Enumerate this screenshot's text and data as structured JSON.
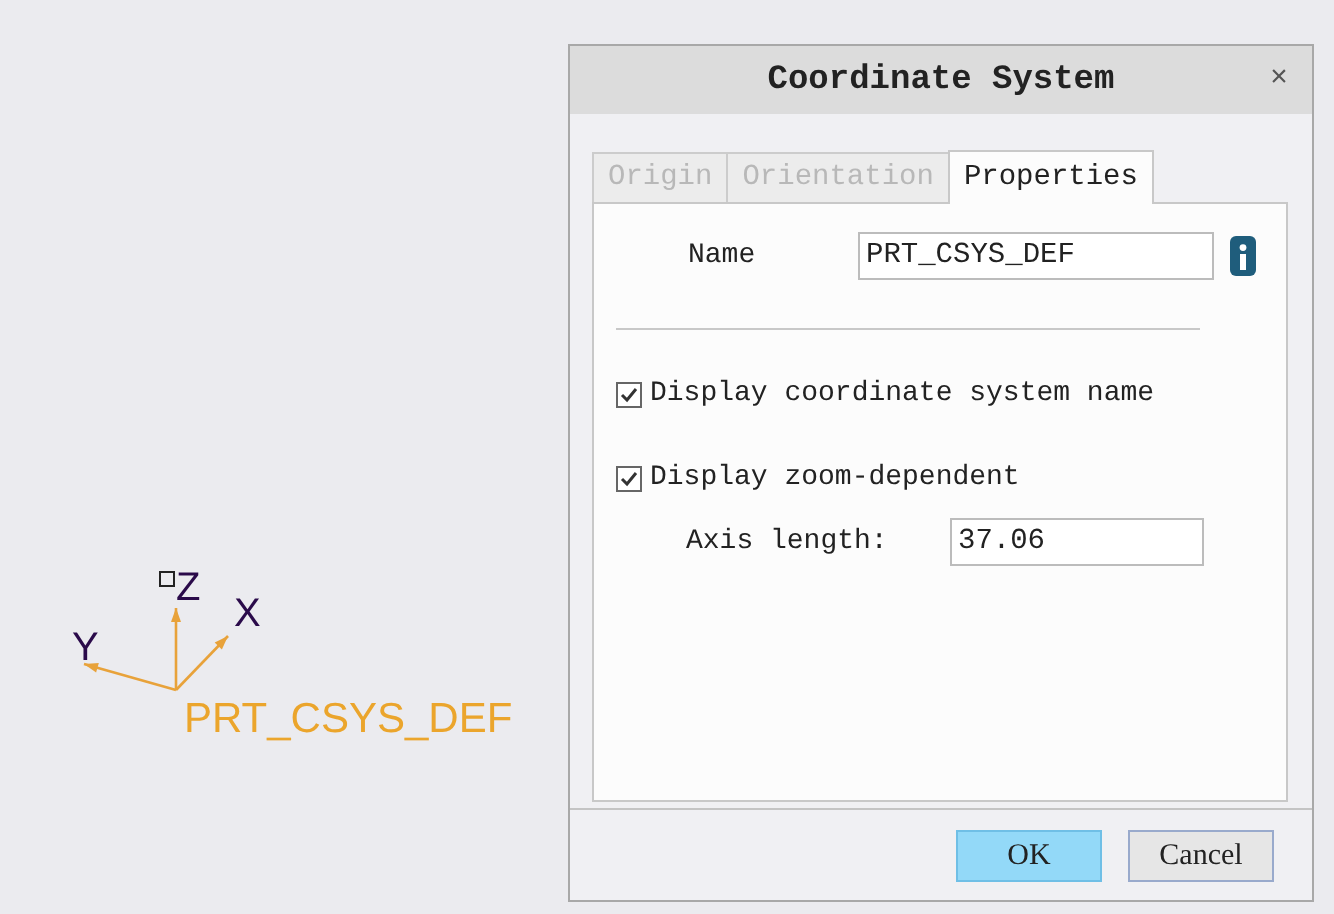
{
  "canvas": {
    "csys_name": "PRT_CSYS_DEF",
    "axes": [
      {
        "kind": "z",
        "label": "Z"
      },
      {
        "kind": "x",
        "label": "X"
      },
      {
        "kind": "y",
        "label": "Y"
      }
    ]
  },
  "dialog": {
    "title": "Coordinate System",
    "close": "×",
    "tabs": [
      {
        "label": "Origin",
        "selected": false,
        "disabled": true
      },
      {
        "label": "Orientation",
        "selected": false,
        "disabled": true
      },
      {
        "label": "Properties",
        "selected": true,
        "disabled": false
      }
    ],
    "name_field": {
      "label": "Name",
      "value": "PRT_CSYS_DEF"
    },
    "options": [
      {
        "label": "Display coordinate system name",
        "checked": true
      },
      {
        "label": "Display zoom-dependent",
        "checked": true
      }
    ],
    "axis_length": {
      "label": "Axis length:",
      "value": "37.06"
    },
    "buttons": [
      {
        "label": "OK",
        "kind": "primary"
      },
      {
        "label": "Cancel",
        "kind": "normal"
      }
    ]
  }
}
